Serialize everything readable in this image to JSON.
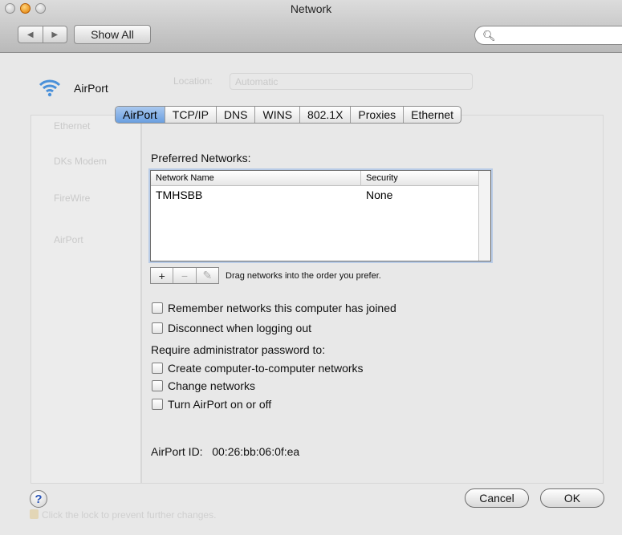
{
  "window": {
    "title": "Network"
  },
  "toolbar": {
    "back_glyph": "◀",
    "forward_glyph": "▶",
    "show_all": "Show All",
    "search_placeholder": ""
  },
  "background": {
    "service_name": "AirPort",
    "location_label": "Location:",
    "location_value": "Automatic",
    "bottom_hint": "Click the lock to prevent further changes.",
    "sidebar": [
      "Ethernet",
      "DKs Modem",
      "FireWire",
      "AirPort"
    ]
  },
  "tabs": [
    "AirPort",
    "TCP/IP",
    "DNS",
    "WINS",
    "802.1X",
    "Proxies",
    "Ethernet"
  ],
  "selected_tab": "AirPort",
  "preferred": {
    "label": "Preferred Networks:",
    "columns": {
      "name": "Network Name",
      "security": "Security"
    },
    "rows": [
      {
        "name": "TMHSBB",
        "security": "None"
      }
    ]
  },
  "list_buttons": {
    "add": "+",
    "remove": "−",
    "edit": "✎"
  },
  "drag_hint": "Drag networks into the order you prefer.",
  "options": {
    "remember": "Remember networks this computer has joined",
    "disconnect": "Disconnect when logging out",
    "require_label": "Require administrator password to:",
    "create": "Create computer-to-computer networks",
    "change": "Change networks",
    "turn": "Turn AirPort on or off"
  },
  "airport_id": "AirPort ID:   00:26:bb:06:0f:ea",
  "buttons": {
    "help": "?",
    "cancel": "Cancel",
    "ok": "OK"
  },
  "colors": {
    "selected_tab": "#6a9fe0",
    "list_focus": "#b8cbe6"
  }
}
